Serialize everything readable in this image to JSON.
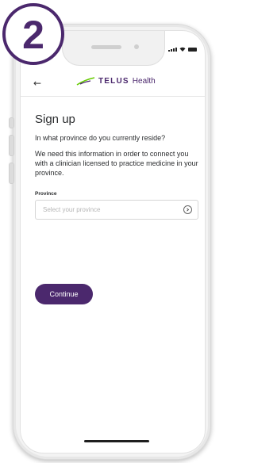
{
  "step": {
    "number": "2"
  },
  "header": {
    "back_icon": "back-arrow-icon",
    "logo_text": "TELUS",
    "logo_suffix": "Health"
  },
  "page": {
    "title": "Sign up",
    "question": "In what province do you currently reside?",
    "description": "We need this information in order to connect you with a clinician licensed to practice medicine in your province."
  },
  "form": {
    "province_label": "Province",
    "province_placeholder": "Select your province",
    "chevron_icon": "chevron-right-icon"
  },
  "actions": {
    "continue_label": "Continue"
  },
  "colors": {
    "brand": "#4b286d",
    "logo_green": "#66cc00"
  }
}
